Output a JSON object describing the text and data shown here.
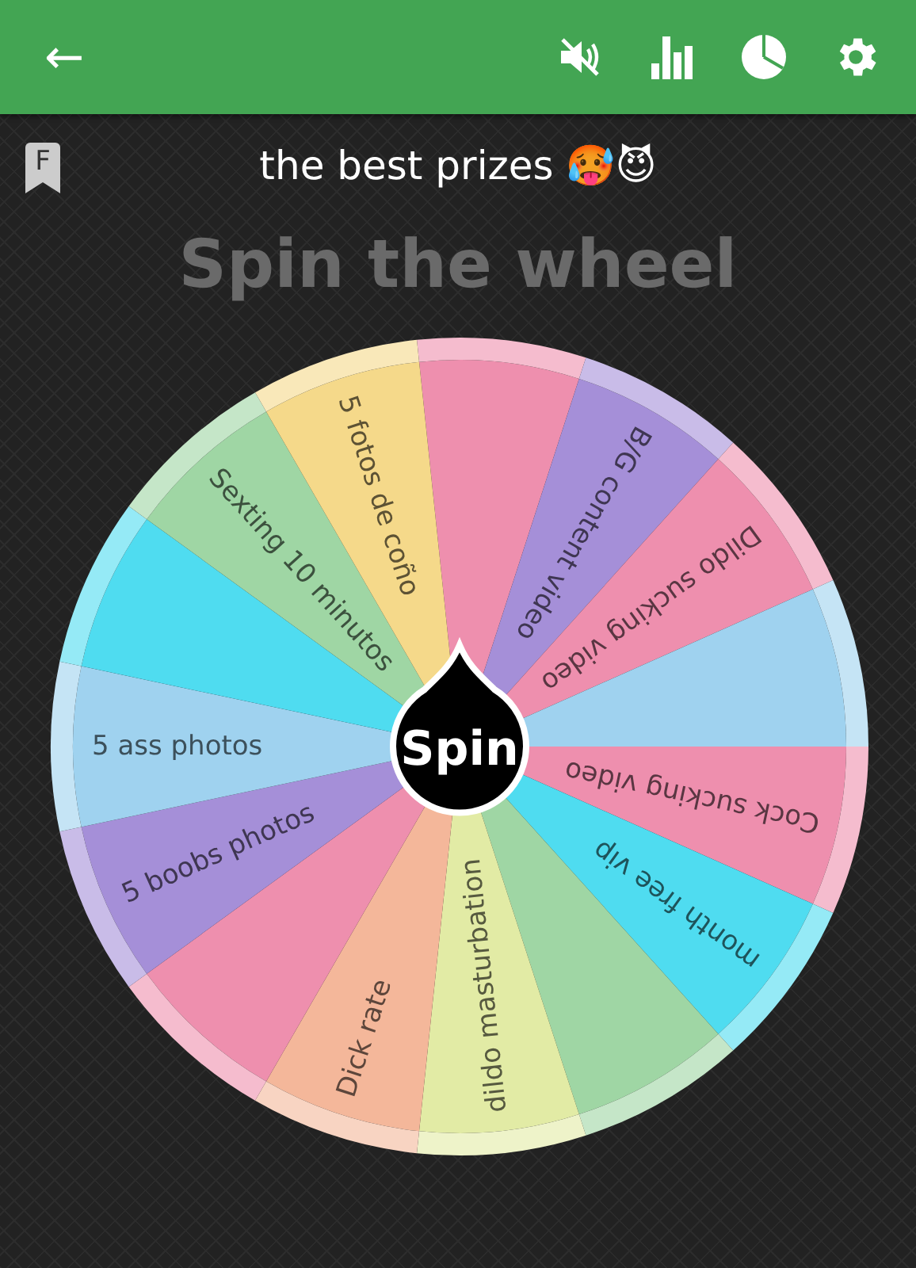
{
  "toolbar": {
    "back": "←"
  },
  "badge": {
    "letter": "F"
  },
  "title": "the best prizes 🥵😈",
  "heading": "Spin the wheel",
  "wheel": {
    "spin_label": "Spin",
    "segments": [
      {
        "color": "#ee8fae"
      },
      {
        "label": "B/G content video",
        "color": "#a58fd8"
      },
      {
        "label": "Dildo sucking video",
        "color": "#ee8fae"
      },
      {
        "color": "#9fd2ef"
      },
      {
        "label": "Cock sucking video",
        "color": "#ee8fae"
      },
      {
        "label": "month free vip",
        "color": "#4fdcf0"
      },
      {
        "color": "#9fd6a4"
      },
      {
        "label": "dildo masturbation",
        "color": "#e2eba5"
      },
      {
        "label": "Dick rate",
        "color": "#f4b79a"
      },
      {
        "color": "#ee8fae"
      },
      {
        "label": "5 boobs photos",
        "color": "#a58fd8"
      },
      {
        "label": "5 ass photos",
        "color": "#9fd2ef"
      },
      {
        "color": "#4fdcf0"
      },
      {
        "label": "Sexting 10 minutos",
        "color": "#9fd6a4"
      },
      {
        "label": "5 fotos de coño",
        "color": "#f5d98a"
      }
    ]
  }
}
